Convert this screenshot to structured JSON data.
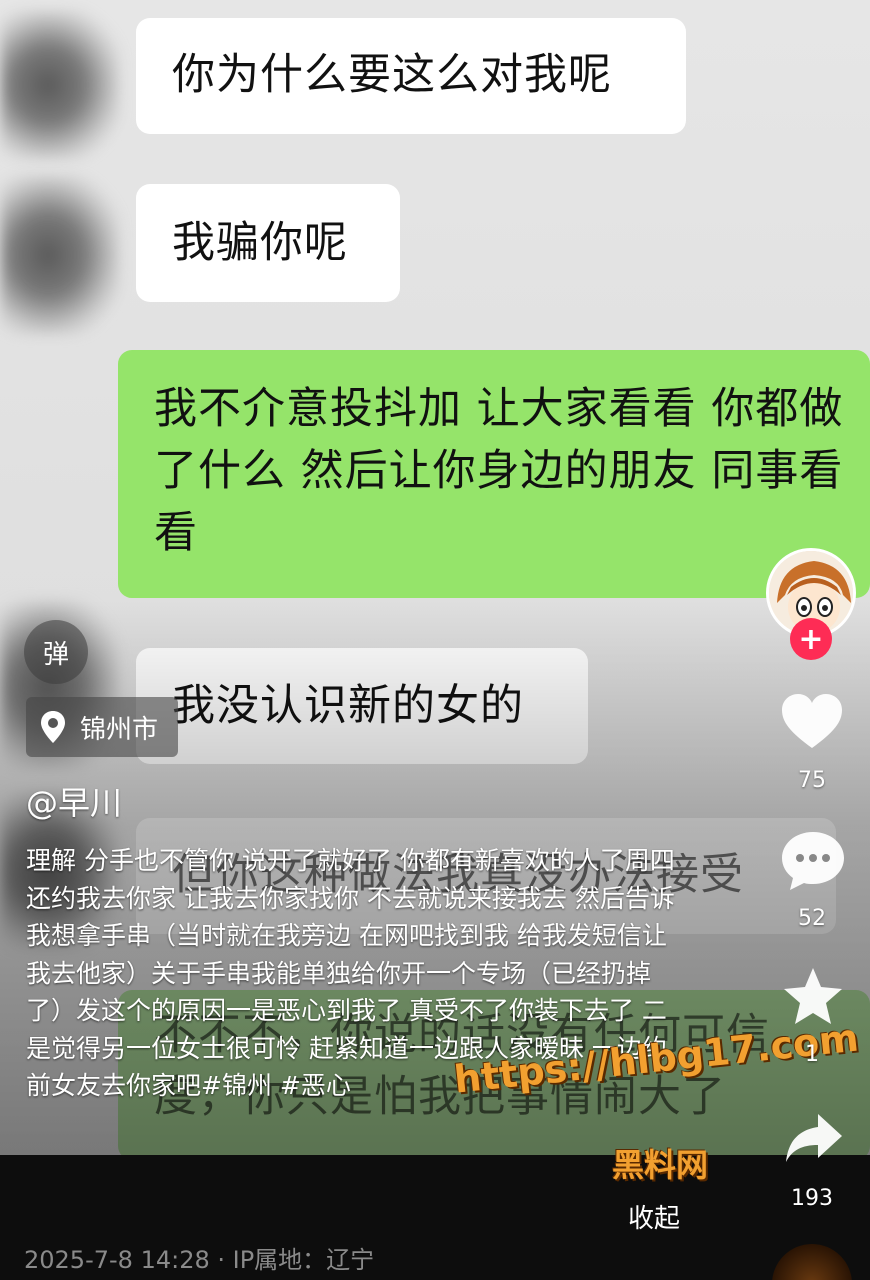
{
  "chat": {
    "messages": [
      {
        "side": "left",
        "text": "你为什么要这么对我呢"
      },
      {
        "side": "left",
        "text": "我骗你呢"
      },
      {
        "side": "right",
        "text": "我不介意投抖加 让大家看看 你都做了什么 然后让你身边的朋友 同事看看"
      },
      {
        "side": "left",
        "text": "我没认识新的女的"
      },
      {
        "side": "left",
        "text": "但你这种做法我真没办法接受"
      },
      {
        "side": "right",
        "text": "不不不，你说的话没有任何可信度，你只是怕我把事情闹大了"
      }
    ]
  },
  "overlay": {
    "danmaku_label": "弹",
    "location": "锦州市",
    "author": "@早川",
    "caption": "理解 分手也不管你 说开了就好了 你都有新喜欢的人了周四还约我去你家 让我去你家找你 不去就说来接我去 然后告诉我想拿手串（当时就在我旁边 在网吧找到我 给我发短信让我去他家）关于手串我能单独给你开一个专场（已经扔掉了）发这个的原因一是恶心到我了 真受不了你装下去了 二是觉得另一位女士很可怜 赶紧知道一边跟人家暧昧 一边约前女友去你家吧#锦州 #恶心",
    "collapse_label": "收起",
    "meta": "2025-7-8 14:28 · IP属地：辽宁",
    "watermark_url": "https://hlbg17.com",
    "watermark_name": "黑料网"
  },
  "actions": {
    "follow_symbol": "+",
    "likes": "75",
    "comments": "52",
    "favorites": "1",
    "shares": "193"
  },
  "colors": {
    "left_bubble": "#ffffff",
    "right_bubble": "#95e46a",
    "follow_button": "#fe2c55",
    "watermark": "#f2a030"
  }
}
